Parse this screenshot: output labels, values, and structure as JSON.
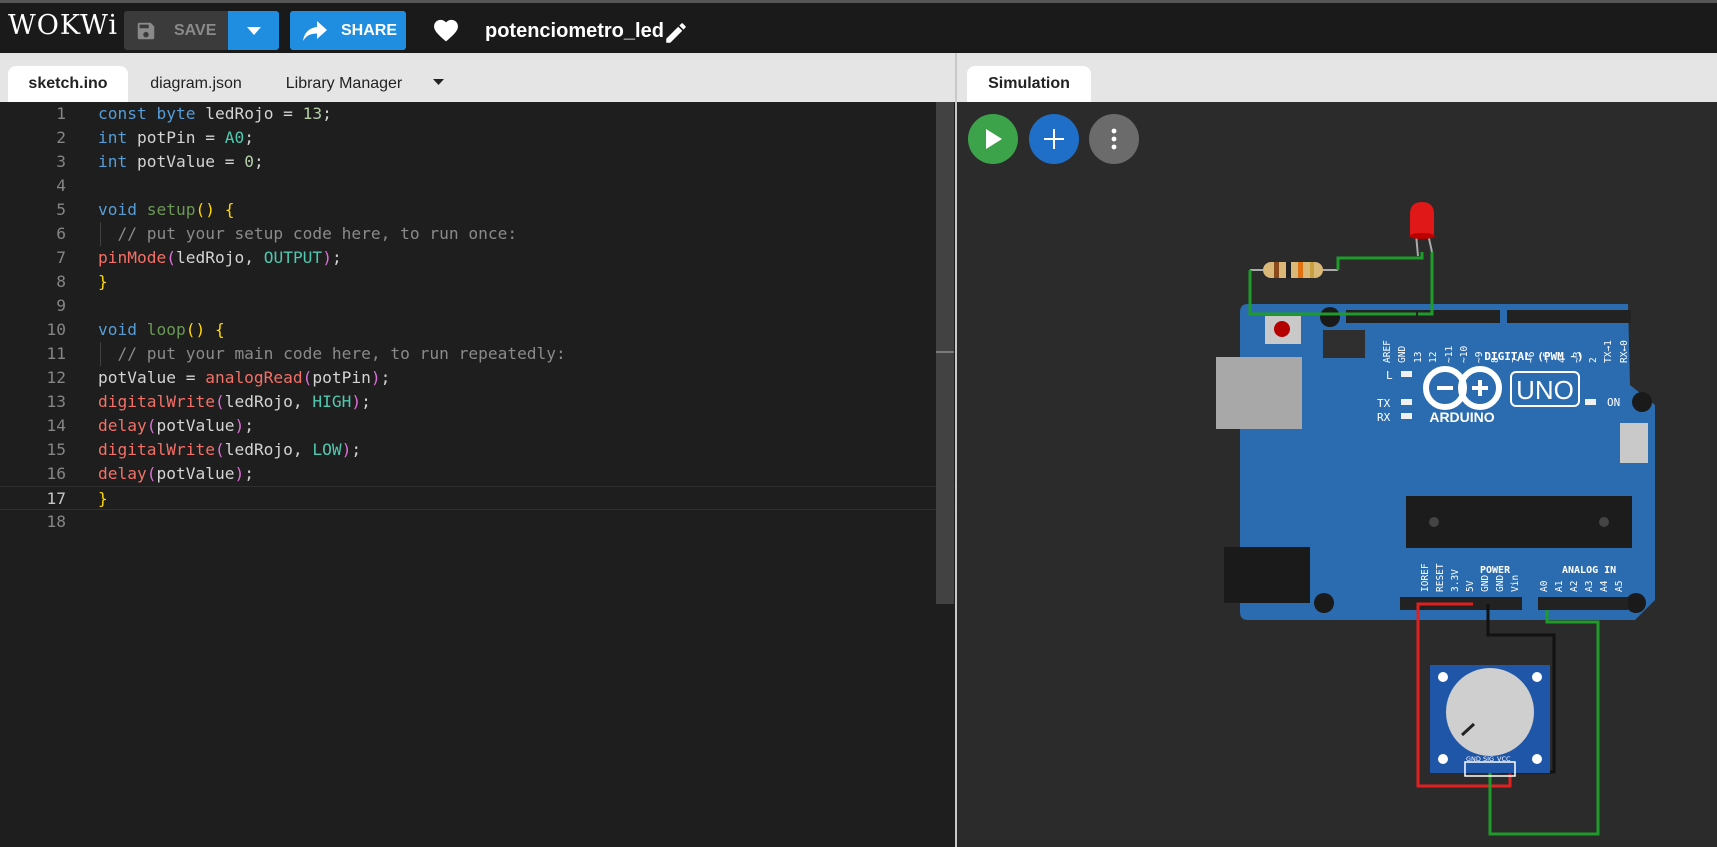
{
  "header": {
    "logo": "WOKWi",
    "save_label": "SAVE",
    "share_label": "SHARE",
    "project_name": "potenciometro_led"
  },
  "editor_tabs": [
    {
      "label": "sketch.ino",
      "active": true
    },
    {
      "label": "diagram.json",
      "active": false
    },
    {
      "label": "Library Manager",
      "active": false
    }
  ],
  "sim_tab": {
    "label": "Simulation"
  },
  "code": {
    "current_line": 17,
    "lines": [
      "const byte ledRojo = 13;",
      "int potPin = A0;",
      "int potValue = 0;",
      "",
      "void setup() {",
      "  // put your setup code here, to run once:",
      "pinMode(ledRojo, OUTPUT);",
      "}",
      "",
      "void loop() {",
      "  // put your main code here, to run repeatedly:",
      "potValue = analogRead(potPin);",
      "digitalWrite(ledRojo, HIGH);",
      "delay(potValue);",
      "digitalWrite(ledRojo, LOW);",
      "delay(potValue);",
      "}",
      ""
    ]
  },
  "board": {
    "brand": "ARDUINO",
    "model": "UNO",
    "digital_header_label": "DIGITAL (PWM ~)",
    "digital_pins": [
      "AREF",
      "GND",
      "13",
      "12",
      "~11",
      "~10",
      "~9",
      "8",
      "7",
      "~6",
      "~5",
      "4",
      "~3",
      "2",
      "TX→1",
      "RX←0"
    ],
    "led_labels": {
      "l": "L",
      "tx": "TX",
      "rx": "RX",
      "on": "ON"
    },
    "power_label": "POWER",
    "power_pins": [
      "IOREF",
      "RESET",
      "3.3V",
      "5V",
      "GND",
      "GND",
      "Vin"
    ],
    "analog_label": "ANALOG IN",
    "analog_pins": [
      "A0",
      "A1",
      "A2",
      "A3",
      "A4",
      "A5"
    ]
  },
  "potentiometer": {
    "pins": [
      "GND",
      "SIG",
      "VCC"
    ]
  },
  "colors": {
    "accent": "#1f8de0",
    "play": "#3da34b",
    "board": "#2b6cb0",
    "wire_green": "#1e9b2a",
    "wire_red": "#e02020"
  }
}
